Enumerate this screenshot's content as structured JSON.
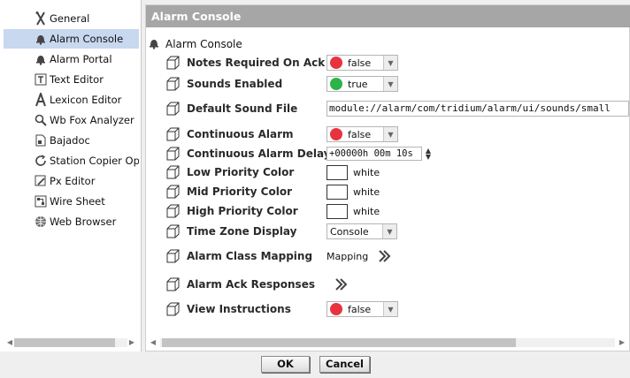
{
  "sidebar": {
    "items": [
      {
        "label": "General",
        "icon": "tools-icon"
      },
      {
        "label": "Alarm Console",
        "icon": "bell-icon",
        "selected": true
      },
      {
        "label": "Alarm Portal",
        "icon": "bell-icon"
      },
      {
        "label": "Text Editor",
        "icon": "text-editor-icon"
      },
      {
        "label": "Lexicon Editor",
        "icon": "lexicon-icon"
      },
      {
        "label": "Wb Fox Analyzer",
        "icon": "magnifier-icon"
      },
      {
        "label": "Bajadoc",
        "icon": "document-icon"
      },
      {
        "label": "Station Copier Optic",
        "icon": "refresh-icon"
      },
      {
        "label": "Px Editor",
        "icon": "px-editor-icon"
      },
      {
        "label": "Wire Sheet",
        "icon": "wire-sheet-icon"
      },
      {
        "label": "Web Browser",
        "icon": "globe-icon"
      }
    ]
  },
  "header": {
    "title": "Alarm Console"
  },
  "root": {
    "label": "Alarm Console"
  },
  "props": {
    "notes_required": {
      "label": "Notes Required On Ack",
      "value": "false"
    },
    "sounds_enabled": {
      "label": "Sounds Enabled",
      "value": "true"
    },
    "default_sound": {
      "label": "Default Sound File",
      "value": "module://alarm/com/tridium/alarm/ui/sounds/small"
    },
    "continuous_alarm": {
      "label": "Continuous Alarm",
      "value": "false"
    },
    "continuous_delay": {
      "label": "Continuous Alarm Delay",
      "value": "+00000h 00m 10s"
    },
    "low_color": {
      "label": "Low Priority Color",
      "value": "white"
    },
    "mid_color": {
      "label": "Mid Priority Color",
      "value": "white"
    },
    "high_color": {
      "label": "High Priority Color",
      "value": "white"
    },
    "time_zone": {
      "label": "Time Zone Display",
      "value": "Console"
    },
    "class_mapping": {
      "label": "Alarm Class Mapping",
      "value": "Mapping"
    },
    "ack_responses": {
      "label": "Alarm Ack Responses"
    },
    "view_instructions": {
      "label": "View Instructions",
      "value": "false"
    }
  },
  "buttons": {
    "ok": "OK",
    "cancel": "Cancel"
  },
  "colors": {
    "false_dot": "#e8333e",
    "true_dot": "#2cb34a",
    "header_bg": "#a6a6a6",
    "selection": "#c7d8ef"
  }
}
